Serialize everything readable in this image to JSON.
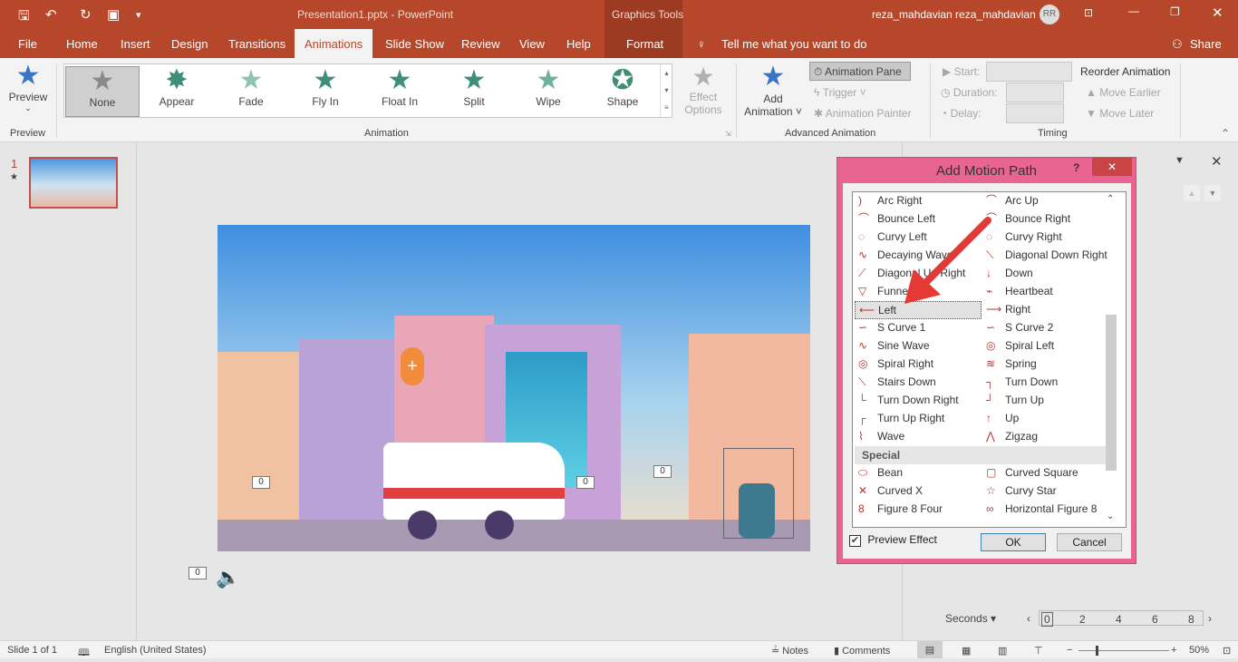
{
  "titlebar": {
    "title": "Presentation1.pptx  -  PowerPoint",
    "context_group": "Graphics Tools",
    "user": "reza_mahdavian reza_mahdavian",
    "avatar_initials": "RR"
  },
  "tabs": [
    "File",
    "Home",
    "Insert",
    "Design",
    "Transitions",
    "Animations",
    "Slide Show",
    "Review",
    "View",
    "Help"
  ],
  "context_tab": "Format",
  "tell_me": "Tell me what you want to do",
  "share": "Share",
  "ribbon": {
    "preview": {
      "label": "Preview",
      "group": "Preview"
    },
    "gallery": [
      "None",
      "Appear",
      "Fade",
      "Fly In",
      "Float In",
      "Split",
      "Wipe",
      "Shape"
    ],
    "gallery_selected": "None",
    "effect_options": [
      "Effect",
      "Options"
    ],
    "animation_group": "Animation",
    "add_animation": [
      "Add",
      "Animation"
    ],
    "animation_pane": "Animation Pane",
    "trigger": "Trigger",
    "animation_painter": "Animation Painter",
    "advanced_group": "Advanced Animation",
    "start": "Start:",
    "duration": "Duration:",
    "delay": "Delay:",
    "reorder": "Reorder Animation",
    "move_earlier": "Move Earlier",
    "move_later": "Move Later",
    "timing_group": "Timing"
  },
  "thumbnails": {
    "number": "1",
    "star": "★"
  },
  "slide": {
    "badges": [
      "0",
      "0",
      "0",
      "0"
    ],
    "audio_badge": "0"
  },
  "dialog": {
    "title": "Add Motion Path",
    "help": "?",
    "left": [
      {
        "icon": "arc-right",
        "label": "Arc Right"
      },
      {
        "icon": "bounce-left",
        "label": "Bounce Left"
      },
      {
        "icon": "curvy-left",
        "label": "Curvy Left"
      },
      {
        "icon": "decaying-wave",
        "label": "Decaying Wave"
      },
      {
        "icon": "diagonal-up-right",
        "label": "Diagonal Up Right"
      },
      {
        "icon": "funnel",
        "label": "Funnel"
      },
      {
        "icon": "left",
        "label": "Left"
      },
      {
        "icon": "s-curve-1",
        "label": "S Curve 1"
      },
      {
        "icon": "sine-wave",
        "label": "Sine Wave"
      },
      {
        "icon": "spiral-right",
        "label": "Spiral Right"
      },
      {
        "icon": "stairs-down",
        "label": "Stairs Down"
      },
      {
        "icon": "turn-down-right",
        "label": "Turn Down Right"
      },
      {
        "icon": "turn-up-right",
        "label": "Turn Up Right"
      },
      {
        "icon": "wave",
        "label": "Wave"
      }
    ],
    "right": [
      {
        "icon": "arc-up",
        "label": "Arc Up"
      },
      {
        "icon": "bounce-right",
        "label": "Bounce Right"
      },
      {
        "icon": "curvy-right",
        "label": "Curvy Right"
      },
      {
        "icon": "diagonal-down-right",
        "label": "Diagonal Down Right"
      },
      {
        "icon": "down",
        "label": "Down"
      },
      {
        "icon": "heartbeat",
        "label": "Heartbeat"
      },
      {
        "icon": "right",
        "label": "Right"
      },
      {
        "icon": "s-curve-2",
        "label": "S Curve 2"
      },
      {
        "icon": "spiral-left",
        "label": "Spiral Left"
      },
      {
        "icon": "spring",
        "label": "Spring"
      },
      {
        "icon": "turn-down",
        "label": "Turn Down"
      },
      {
        "icon": "turn-up",
        "label": "Turn Up"
      },
      {
        "icon": "up",
        "label": "Up"
      },
      {
        "icon": "zigzag",
        "label": "Zigzag"
      }
    ],
    "selected": "Left",
    "special_header": "Special",
    "special_left": [
      {
        "icon": "bean",
        "label": "Bean"
      },
      {
        "icon": "curved-x",
        "label": "Curved X"
      },
      {
        "icon": "figure-8-four",
        "label": "Figure 8 Four"
      }
    ],
    "special_right": [
      {
        "icon": "curved-square",
        "label": "Curved Square"
      },
      {
        "icon": "curvy-star",
        "label": "Curvy Star"
      },
      {
        "icon": "horizontal-figure-8",
        "label": "Horizontal Figure 8"
      }
    ],
    "preview_effect": "Preview Effect",
    "preview_checked": true,
    "ok": "OK",
    "cancel": "Cancel"
  },
  "timeline": {
    "unit": "Seconds",
    "ticks": [
      "0",
      "2",
      "4",
      "6",
      "8"
    ]
  },
  "status": {
    "slide": "Slide 1 of 1",
    "language": "English (United States)",
    "notes": "Notes",
    "comments": "Comments",
    "zoom": "50%"
  },
  "colors": {
    "accent": "#b7472a",
    "dialog_border": "#e86592",
    "arrow": "#e53935"
  }
}
